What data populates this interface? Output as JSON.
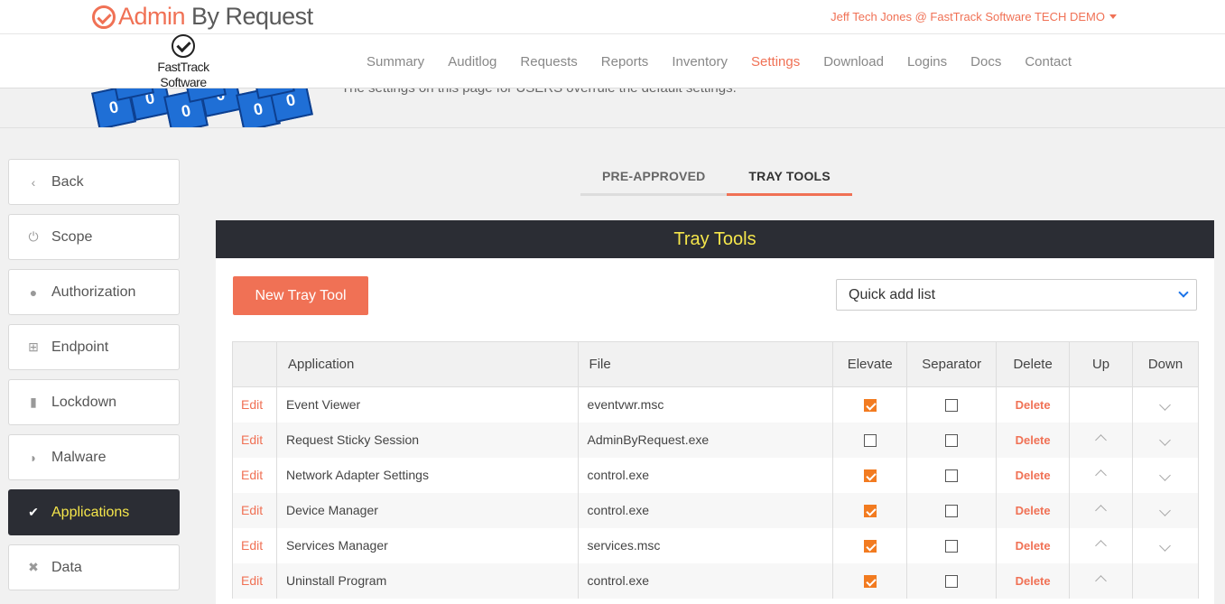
{
  "header": {
    "brand_part1": "Admin",
    "brand_part2": "By Request",
    "user": "Jeff Tech Jones @ FastTrack Software TECH DEMO",
    "company_logo_line1": "FastTrack",
    "company_logo_line2": "Software"
  },
  "nav": {
    "items": [
      "Summary",
      "Auditlog",
      "Requests",
      "Reports",
      "Inventory",
      "Settings",
      "Download",
      "Logins",
      "Docs",
      "Contact"
    ],
    "active": "Settings"
  },
  "banner": {
    "text": "The settings on this page for USERS overrule the default settings.",
    "cube_glyph": "0"
  },
  "sidebar": {
    "items": [
      {
        "label": "Back",
        "icon": "chevron-left-icon",
        "glyph": "‹"
      },
      {
        "label": "Scope",
        "icon": "power-icon",
        "glyph": "⏻"
      },
      {
        "label": "Authorization",
        "icon": "user-icon",
        "glyph": "●"
      },
      {
        "label": "Endpoint",
        "icon": "windows-icon",
        "glyph": "⊞"
      },
      {
        "label": "Lockdown",
        "icon": "lock-icon",
        "glyph": "▮"
      },
      {
        "label": "Malware",
        "icon": "shield-icon",
        "glyph": "◗"
      },
      {
        "label": "Applications",
        "icon": "check-circle-icon",
        "glyph": "✔"
      },
      {
        "label": "Data",
        "icon": "user-x-icon",
        "glyph": "✖"
      }
    ],
    "active": "Applications"
  },
  "tabs": [
    {
      "label": "PRE-APPROVED",
      "active": false
    },
    {
      "label": "TRAY TOOLS",
      "active": true
    }
  ],
  "panel": {
    "title": "Tray Tools",
    "new_button": "New Tray Tool",
    "quick_add": "Quick add list"
  },
  "table": {
    "headers": [
      "",
      "Application",
      "File",
      "Elevate",
      "Separator",
      "Delete",
      "Up",
      "Down"
    ],
    "rows": [
      {
        "edit": "Edit",
        "application": "Event Viewer",
        "file": "eventvwr.msc",
        "elevate": true,
        "separator": false,
        "delete": "Delete",
        "up": false,
        "down": true
      },
      {
        "edit": "Edit",
        "application": "Request Sticky Session",
        "file": "AdminByRequest.exe",
        "elevate": false,
        "separator": false,
        "delete": "Delete",
        "up": true,
        "down": true
      },
      {
        "edit": "Edit",
        "application": "Network Adapter Settings",
        "file": "control.exe",
        "elevate": true,
        "separator": false,
        "delete": "Delete",
        "up": true,
        "down": true
      },
      {
        "edit": "Edit",
        "application": "Device Manager",
        "file": "control.exe",
        "elevate": true,
        "separator": false,
        "delete": "Delete",
        "up": true,
        "down": true
      },
      {
        "edit": "Edit",
        "application": "Services Manager",
        "file": "services.msc",
        "elevate": true,
        "separator": false,
        "delete": "Delete",
        "up": true,
        "down": true
      },
      {
        "edit": "Edit",
        "application": "Uninstall Program",
        "file": "control.exe",
        "elevate": true,
        "separator": false,
        "delete": "Delete",
        "up": true,
        "down": false
      }
    ]
  },
  "colors": {
    "accent": "#f07155",
    "dark": "#2b2d34",
    "highlight": "#f5e64b",
    "checkbox": "#f27b20"
  }
}
